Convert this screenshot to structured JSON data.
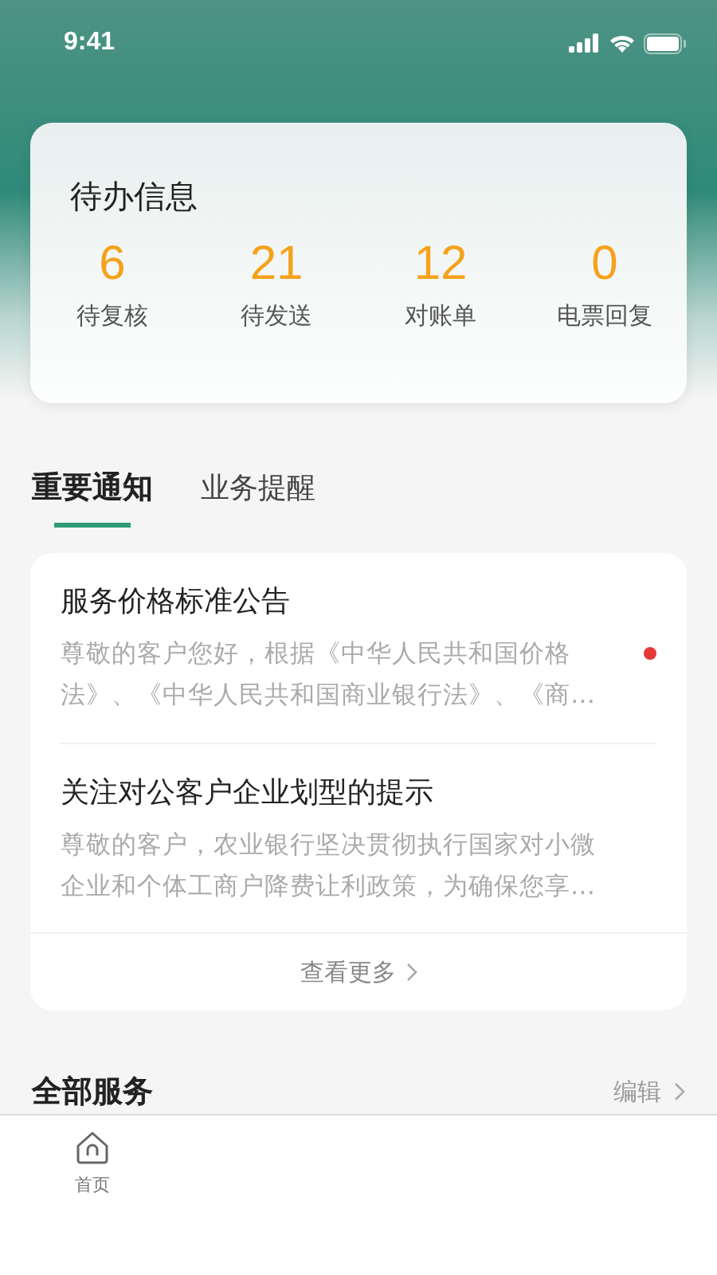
{
  "status_bar": {
    "time": "9:41"
  },
  "todo": {
    "title": "待办信息",
    "stats": [
      {
        "value": "6",
        "label": "待复核"
      },
      {
        "value": "21",
        "label": "待发送"
      },
      {
        "value": "12",
        "label": "对账单"
      },
      {
        "value": "0",
        "label": "电票回复"
      }
    ]
  },
  "tabs": [
    {
      "label": "重要通知",
      "selected": true
    },
    {
      "label": "业务提醒",
      "selected": false
    }
  ],
  "notices": [
    {
      "title": "服务价格标准公告",
      "summary": "尊敬的客户您好，根据《中华人民共和国价格法》、《中华人民共和国商业银行法》、《商…",
      "unread": true
    },
    {
      "title": "关注对公客户企业划型的提示",
      "summary": "尊敬的客户，农业银行坚决贯彻执行国家对小微企业和个体工商户降费让利政策，为确保您享…",
      "unread": false
    }
  ],
  "more_link": "查看更多",
  "services": {
    "title": "全部服务",
    "edit": "编辑"
  },
  "bottom_nav": [
    {
      "label": "首页",
      "selected": false
    }
  ]
}
